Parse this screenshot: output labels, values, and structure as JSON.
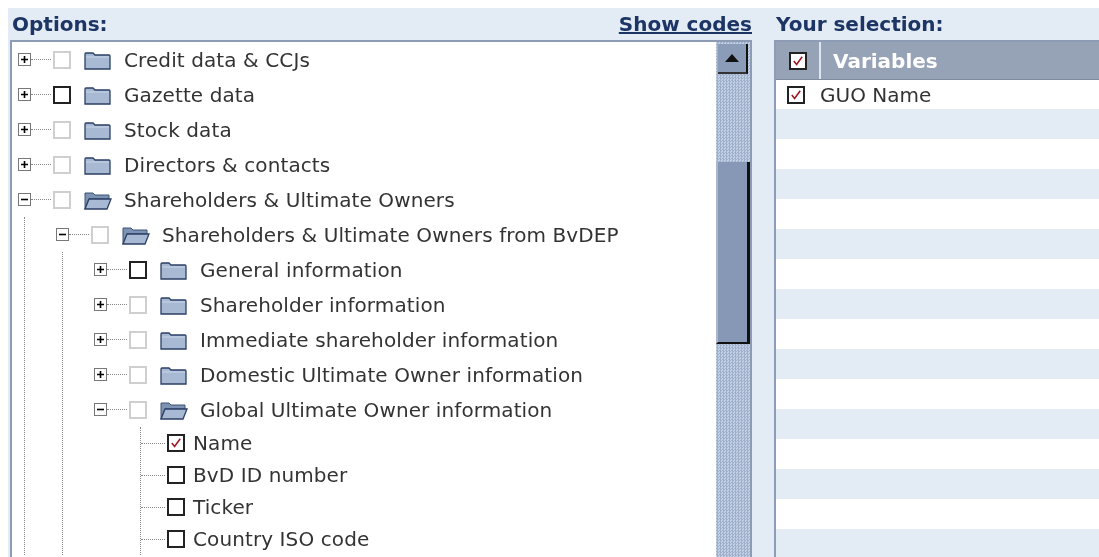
{
  "options": {
    "title": "Options:",
    "link": "Show codes"
  },
  "tree": [
    {
      "kind": "folder",
      "label": "Credit data & CCJs",
      "expanded": false,
      "disabled": true,
      "checked": false
    },
    {
      "kind": "folder",
      "label": "Gazette data",
      "expanded": false,
      "disabled": false,
      "checked": false
    },
    {
      "kind": "folder",
      "label": "Stock data",
      "expanded": false,
      "disabled": true,
      "checked": false
    },
    {
      "kind": "folder",
      "label": "Directors & contacts",
      "expanded": false,
      "disabled": true,
      "checked": false
    },
    {
      "kind": "folder",
      "label": "Shareholders & Ultimate Owners",
      "expanded": true,
      "disabled": true,
      "checked": false,
      "children": [
        {
          "kind": "folder",
          "label": "Shareholders & Ultimate Owners from BvDEP",
          "expanded": true,
          "disabled": true,
          "checked": false,
          "children": [
            {
              "kind": "folder",
              "label": "General information",
              "expanded": false,
              "disabled": false,
              "checked": false
            },
            {
              "kind": "folder",
              "label": "Shareholder information",
              "expanded": false,
              "disabled": true,
              "checked": false
            },
            {
              "kind": "folder",
              "label": "Immediate shareholder information",
              "expanded": false,
              "disabled": true,
              "checked": false
            },
            {
              "kind": "folder",
              "label": "Domestic Ultimate Owner information",
              "expanded": false,
              "disabled": true,
              "checked": false
            },
            {
              "kind": "folder",
              "label": "Global Ultimate Owner information",
              "expanded": true,
              "disabled": true,
              "checked": false,
              "children": [
                {
                  "kind": "field",
                  "label": "Name",
                  "disabled": false,
                  "checked": true
                },
                {
                  "kind": "field",
                  "label": "BvD ID number",
                  "disabled": false,
                  "checked": false
                },
                {
                  "kind": "field",
                  "label": "Ticker",
                  "disabled": false,
                  "checked": false
                },
                {
                  "kind": "field",
                  "label": "Country ISO code",
                  "disabled": false,
                  "checked": false
                }
              ]
            }
          ]
        }
      ]
    }
  ],
  "selection": {
    "title": "Your selection:",
    "header_checked": true,
    "column": "Variables",
    "rows": [
      {
        "label": "GUO Name",
        "checked": true
      }
    ]
  }
}
